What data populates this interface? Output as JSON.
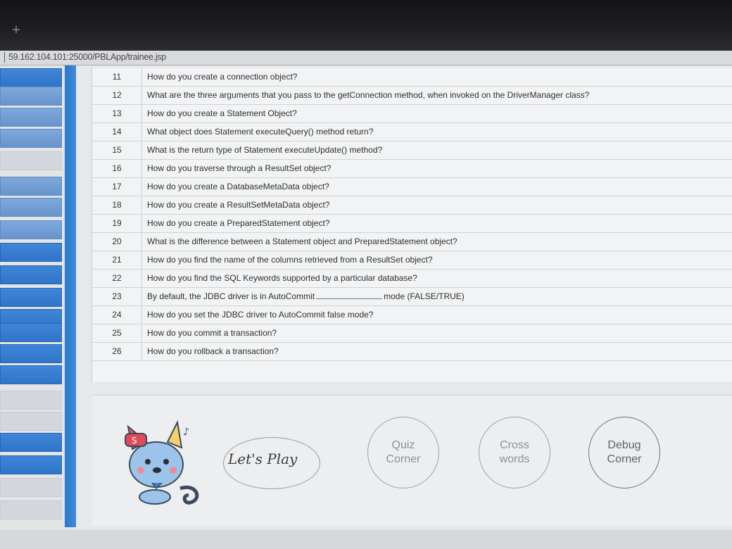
{
  "browser": {
    "url": "59.162.104.101:25000/PBLApp/trainee.jsp",
    "new_tab_symbol": "+"
  },
  "questions": [
    {
      "num": "11",
      "text": "How do you create a connection object?"
    },
    {
      "num": "12",
      "text": "What are the three arguments that you pass to the getConnection method, when invoked on the DriverManager class?"
    },
    {
      "num": "13",
      "text": "How do you create a Statement Object?"
    },
    {
      "num": "14",
      "text": "What object does Statement executeQuery() method return?"
    },
    {
      "num": "15",
      "text": "What is the return type of Statement executeUpdate() method?"
    },
    {
      "num": "16",
      "text": "How do you traverse through a ResultSet object?"
    },
    {
      "num": "17",
      "text": "How do you create a DatabaseMetaData object?"
    },
    {
      "num": "18",
      "text": "How do you create a ResultSetMetaData object?"
    },
    {
      "num": "19",
      "text": "How do you create a PreparedStatement object?"
    },
    {
      "num": "20",
      "text": "What is the difference between a Statement object and PreparedStatement object?"
    },
    {
      "num": "21",
      "text": "How do you find the name of the columns retrieved from a ResultSet object?"
    },
    {
      "num": "22",
      "text": "How do you find the SQL Keywords supported by a particular database?"
    },
    {
      "num": "23",
      "text_before": "By default, the JDBC driver is in AutoCommit",
      "text_after": "mode (FALSE/TRUE)"
    },
    {
      "num": "24",
      "text": "How do you set the JDBC driver to AutoCommit false mode?"
    },
    {
      "num": "25",
      "text": "How do you commit a transaction?"
    },
    {
      "num": "26",
      "text": "How do you rollback a transaction?"
    }
  ],
  "bottom": {
    "mascot_icon": "cat-mascot-icon",
    "lets_play": "Let's Play",
    "buttons": [
      {
        "line1": "Quiz",
        "line2": "Corner"
      },
      {
        "line1": "Cross",
        "line2": "words"
      },
      {
        "line1": "Debug",
        "line2": "Corner"
      }
    ]
  },
  "colors": {
    "sidebar_blue": "#2f74c8",
    "circle_border": "#9da0a6"
  }
}
